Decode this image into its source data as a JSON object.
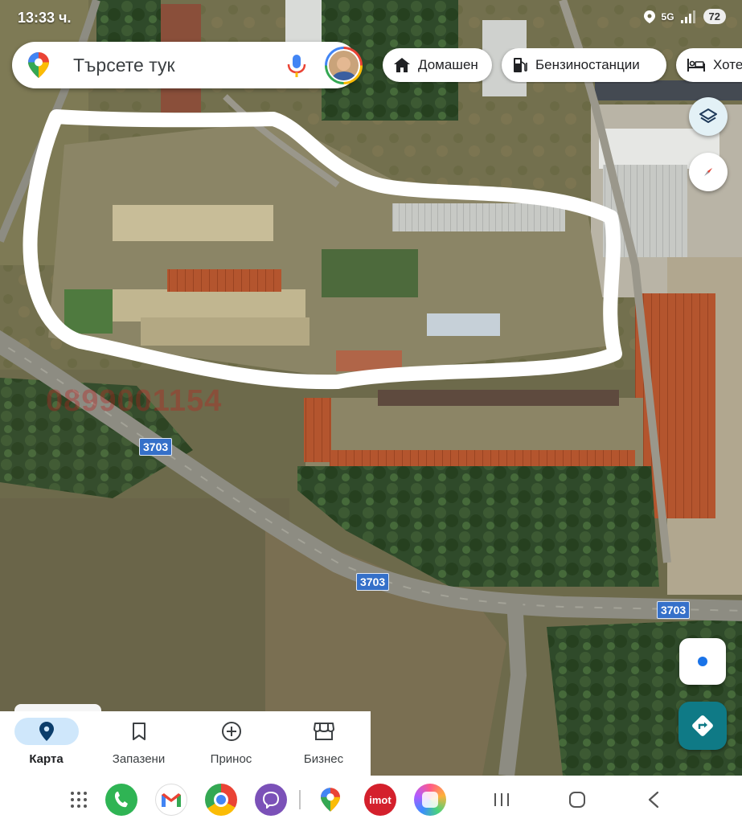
{
  "status_bar": {
    "time": "13:33 ч.",
    "network": "5G",
    "battery": "72"
  },
  "search": {
    "placeholder": "Търсете тук"
  },
  "chips": [
    {
      "label": "Домашен",
      "icon": "home-icon"
    },
    {
      "label": "Бензиностанции",
      "icon": "gas-station-icon"
    },
    {
      "label": "Хоте",
      "icon": "hotel-icon"
    }
  ],
  "map": {
    "road_labels": [
      "3703",
      "3703",
      "3703"
    ],
    "watermark": "0899001154"
  },
  "bottom_nav": [
    {
      "label": "Карта",
      "icon": "explore-pin-icon",
      "active": true
    },
    {
      "label": "Запазени",
      "icon": "bookmark-icon",
      "active": false
    },
    {
      "label": "Принос",
      "icon": "add-circle-icon",
      "active": false
    },
    {
      "label": "Бизнес",
      "icon": "storefront-icon",
      "active": false
    }
  ],
  "dock": {
    "apps": [
      "app-drawer-icon",
      "phone-icon",
      "gmail-icon",
      "chrome-icon",
      "viber-icon",
      "maps-icon",
      "imot-icon",
      "gallery-icon"
    ],
    "imot_label": "imot"
  },
  "colors": {
    "accent": "#1a73e8",
    "directions": "#0f7a86",
    "active_nav": "#cfe7fb"
  }
}
